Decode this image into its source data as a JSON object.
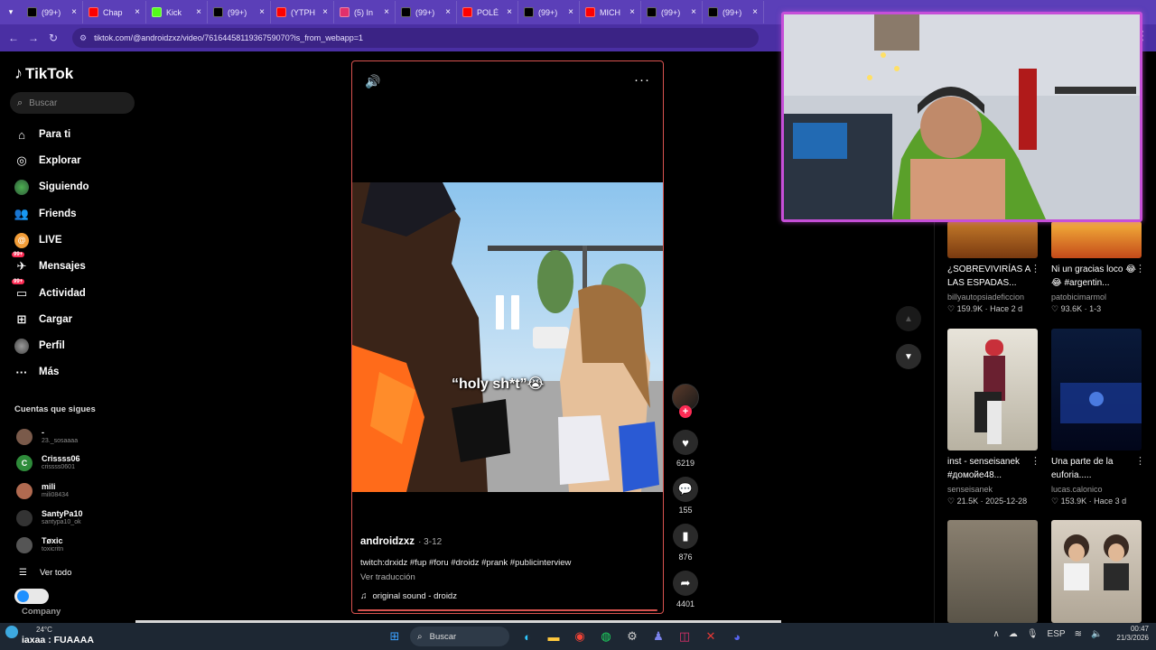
{
  "browser": {
    "tabs": [
      {
        "label": "(99+)",
        "favicon": "tiktok",
        "color": "#000000"
      },
      {
        "label": "Chap",
        "favicon": "youtube",
        "color": "#ff0000"
      },
      {
        "label": "Kick",
        "favicon": "kick",
        "color": "#53fc18"
      },
      {
        "label": "(99+)",
        "favicon": "tiktok",
        "color": "#000000"
      },
      {
        "label": "(YTPH",
        "favicon": "youtube",
        "color": "#ff0000"
      },
      {
        "label": "(5) In",
        "favicon": "instagram",
        "color": "#e1306c"
      },
      {
        "label": "(99+)",
        "favicon": "tiktok",
        "color": "#000000"
      },
      {
        "label": "POLÉ",
        "favicon": "youtube",
        "color": "#ff0000"
      },
      {
        "label": "(99+)",
        "favicon": "tiktok",
        "color": "#000000"
      },
      {
        "label": "MICH",
        "favicon": "youtube",
        "color": "#ff0000"
      },
      {
        "label": "(99+)",
        "favicon": "tiktok",
        "color": "#000000"
      },
      {
        "label": "(99+)",
        "favicon": "tiktok",
        "color": "#000000"
      }
    ],
    "url": "tiktok.com/@androidzxz/video/7616445811936759070?is_from_webapp=1"
  },
  "sidebar": {
    "logo": "TikTok",
    "search_placeholder": "Buscar",
    "nav": [
      {
        "label": "Para ti",
        "icon": "home-icon"
      },
      {
        "label": "Explorar",
        "icon": "compass-icon"
      },
      {
        "label": "Siguiendo",
        "icon": "following-avatar-icon"
      },
      {
        "label": "Friends",
        "icon": "friends-icon"
      },
      {
        "label": "LIVE",
        "icon": "live-icon"
      },
      {
        "label": "Mensajes",
        "icon": "messages-icon",
        "badge": "99+"
      },
      {
        "label": "Actividad",
        "icon": "activity-icon",
        "badge": "99+"
      },
      {
        "label": "Cargar",
        "icon": "upload-icon"
      },
      {
        "label": "Perfil",
        "icon": "profile-icon"
      },
      {
        "label": "Más",
        "icon": "more-icon"
      }
    ],
    "following_title": "Cuentas que sigues",
    "following": [
      {
        "name": "-",
        "handle": "23._sosaaaa",
        "color": "#7a5a4a",
        "initial": ""
      },
      {
        "name": "Crissss06",
        "handle": "crissss0601",
        "color": "#2e8b3a",
        "initial": "C"
      },
      {
        "name": "mili",
        "handle": "mili08434",
        "color": "#b06a50",
        "initial": ""
      },
      {
        "name": "SantyPa10",
        "handle": "santypa10_ok",
        "color": "#333333",
        "initial": ""
      },
      {
        "name": "Tøxic",
        "handle": "toxicritn",
        "color": "#555555",
        "initial": ""
      }
    ],
    "see_all": "Ver todo",
    "company": "Company"
  },
  "video": {
    "caption": "“holy sh*t”😭",
    "author": "androidzxz",
    "date": "· 3-12",
    "description": "twitch:drxidz #fup #foru #droidz #prank #publicinterview",
    "translate": "Ver traducción",
    "sound": "original sound - droidz",
    "likes": "6219",
    "comments": "155",
    "saves": "876",
    "shares": "4401"
  },
  "right_col": [
    {
      "title": "¿SOBREVIVIRÍAS A LAS ESPADAS...",
      "author": "billyautopsiadeficcion",
      "likes": "159.9K",
      "when": "· Hace 2 d"
    },
    {
      "title": "Ni un gracias loco 😂😂 #argentin...",
      "author": "patobicimarmol",
      "likes": "93.6K",
      "when": "· 1-3"
    },
    {
      "title": "inst - senseisanek #домойе48...",
      "author": "senseisanek",
      "likes": "21.5K",
      "when": "· 2025-12-28"
    },
    {
      "title": "Una parte de la euforia.....",
      "author": "lucas.calonico",
      "likes": "153.9K",
      "when": "· Hace 3 d"
    }
  ],
  "taskbar": {
    "temp": "24°C",
    "title": "iaxaa : FUAAAA",
    "search_placeholder": "Buscar",
    "lang": "ESP",
    "time": "00:47",
    "date": "21/3/2026"
  }
}
